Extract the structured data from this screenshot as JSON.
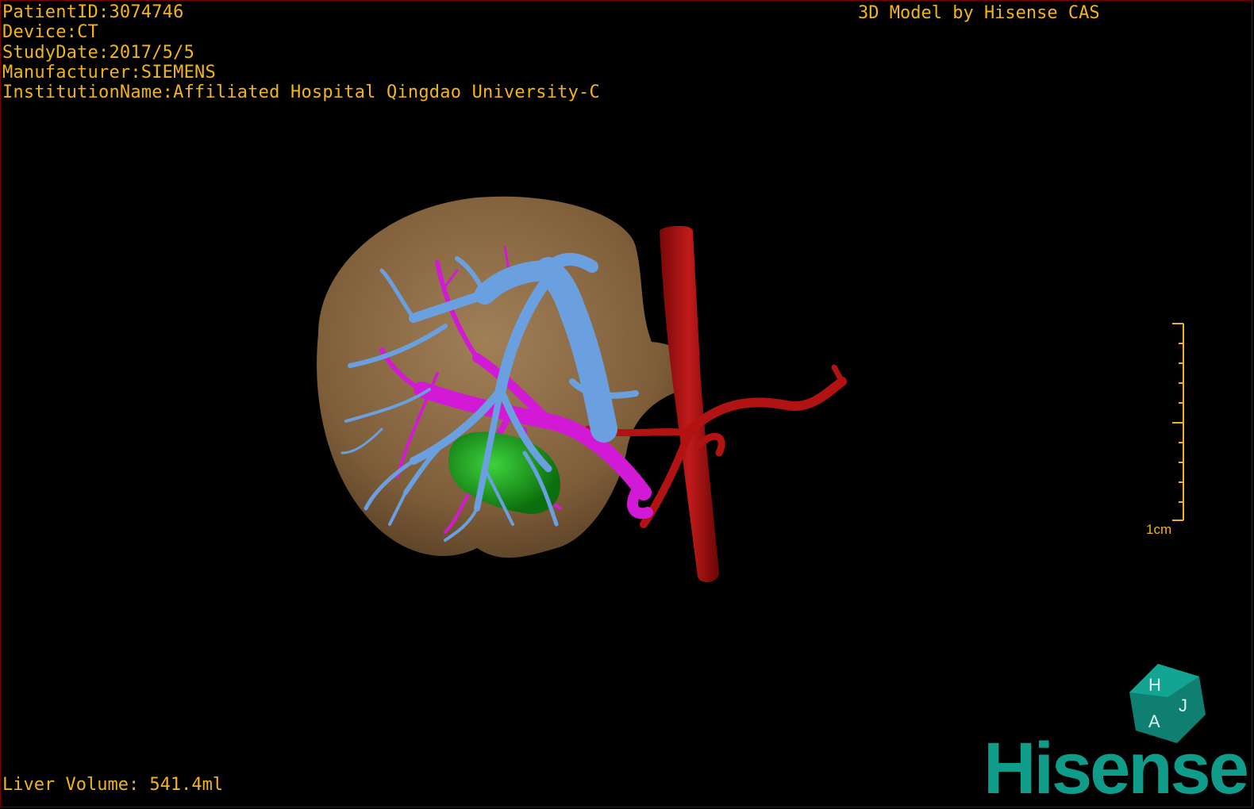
{
  "overlay": {
    "patient_id": "PatientID:3074746",
    "device": "Device:CT",
    "study_date": "StudyDate:2017/5/5",
    "manufacturer": "Manufacturer:SIEMENS",
    "institution": "InstitutionName:Affiliated Hospital Qingdao University-C",
    "model_credit": "3D Model by Hisense CAS",
    "liver_volume": "Liver Volume: 541.4ml",
    "scale_label": "1cm"
  },
  "logo": {
    "cube_letters": [
      "H",
      "A",
      "J"
    ],
    "wordmark": "Hisense"
  },
  "colors": {
    "overlay_text": "#f2b417",
    "liver": "#b58a5a",
    "portal_vein": "#6aa0e0",
    "hepatic_vein": "#d21ad6",
    "artery": "#b11212",
    "lesion": "#1ea81e",
    "brand": "#0f9c8a"
  },
  "model": {
    "structures": [
      "liver",
      "hepatic-vein",
      "portal-vein",
      "aorta",
      "celiac-artery",
      "lesion"
    ]
  }
}
